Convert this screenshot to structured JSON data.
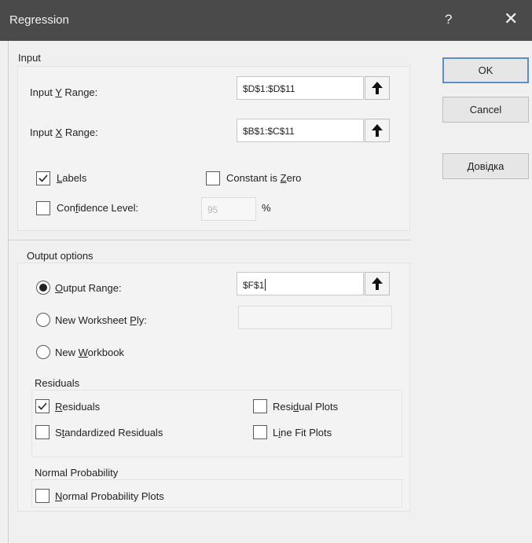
{
  "window": {
    "title": "Regression",
    "help_glyph": "?",
    "close_glyph": "✕"
  },
  "buttons": {
    "ok": "OK",
    "cancel": "Cancel",
    "help": "Довідка"
  },
  "input": {
    "section_label": "Input",
    "y_range": {
      "label_pre": "Input ",
      "label_key": "Y",
      "label_post": " Range:",
      "value": "$D$1:$D$11"
    },
    "x_range": {
      "label_pre": "Input ",
      "label_key": "X",
      "label_post": " Range:",
      "value": "$B$1:$C$11"
    },
    "labels": {
      "label_key": "L",
      "label_post": "abels",
      "checked": true
    },
    "constant_zero": {
      "label_pre": "Constant is ",
      "label_key": "Z",
      "label_post": "ero",
      "checked": false
    },
    "confidence": {
      "label_pre": "Con",
      "label_key": "f",
      "label_post": "idence Level:",
      "checked": false,
      "value": "95",
      "unit": "%"
    }
  },
  "output": {
    "section_label": "Output options",
    "output_range": {
      "label_key": "O",
      "label_post": "utput Range:",
      "selected": true,
      "value": "$F$1"
    },
    "new_worksheet": {
      "label_pre": "New Worksheet ",
      "label_key": "P",
      "label_post": "ly:",
      "selected": false,
      "value": ""
    },
    "new_workbook": {
      "label_pre": "New ",
      "label_key": "W",
      "label_post": "orkbook",
      "selected": false
    }
  },
  "residuals": {
    "section_label": "Residuals",
    "residuals": {
      "label_key": "R",
      "label_post": "esiduals",
      "checked": true
    },
    "standardized": {
      "label_pre": "S",
      "label_key": "t",
      "label_post": "andardized Residuals",
      "checked": false
    },
    "residual_plots": {
      "label_pre": "Resi",
      "label_key": "d",
      "label_post": "ual Plots",
      "checked": false
    },
    "line_fit_plots": {
      "label_pre": "L",
      "label_key": "i",
      "label_post": "ne Fit Plots",
      "checked": false
    }
  },
  "normal_probability": {
    "section_label": "Normal Probability",
    "plots": {
      "label_key": "N",
      "label_post": "ormal Probability Plots",
      "checked": false
    }
  },
  "icons": {
    "range_picker": "arrow-up-icon",
    "check": "checkmark-icon"
  }
}
